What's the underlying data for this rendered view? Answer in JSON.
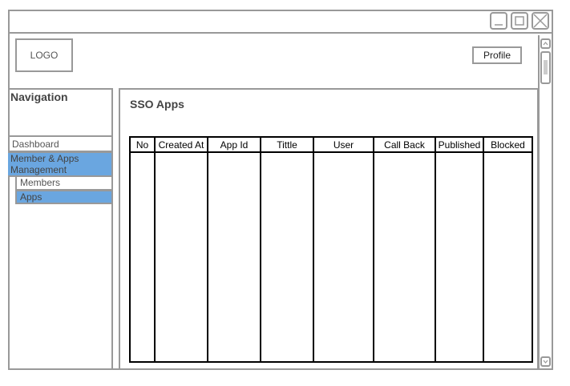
{
  "header": {
    "logo_text": "LOGO",
    "profile_label": "Profile"
  },
  "window_controls": {
    "icons": [
      "minimize-icon",
      "maximize-icon",
      "close-icon"
    ]
  },
  "navigation": {
    "title": "Navigation",
    "items": [
      {
        "label": "Dashboard",
        "selected": false
      },
      {
        "label": "Member & Apps Management",
        "selected": true,
        "children": [
          {
            "label": "Members",
            "selected": false
          },
          {
            "label": "Apps",
            "selected": true
          }
        ]
      }
    ]
  },
  "content": {
    "title": "SSO Apps",
    "table": {
      "columns": [
        "No",
        "Created At",
        "App Id",
        "Tittle",
        "User",
        "Call Back",
        "Published",
        "Blocked"
      ],
      "rows": []
    }
  },
  "colors": {
    "border": "#999999",
    "selected": "#6aa6e0",
    "table_border": "#000000"
  }
}
